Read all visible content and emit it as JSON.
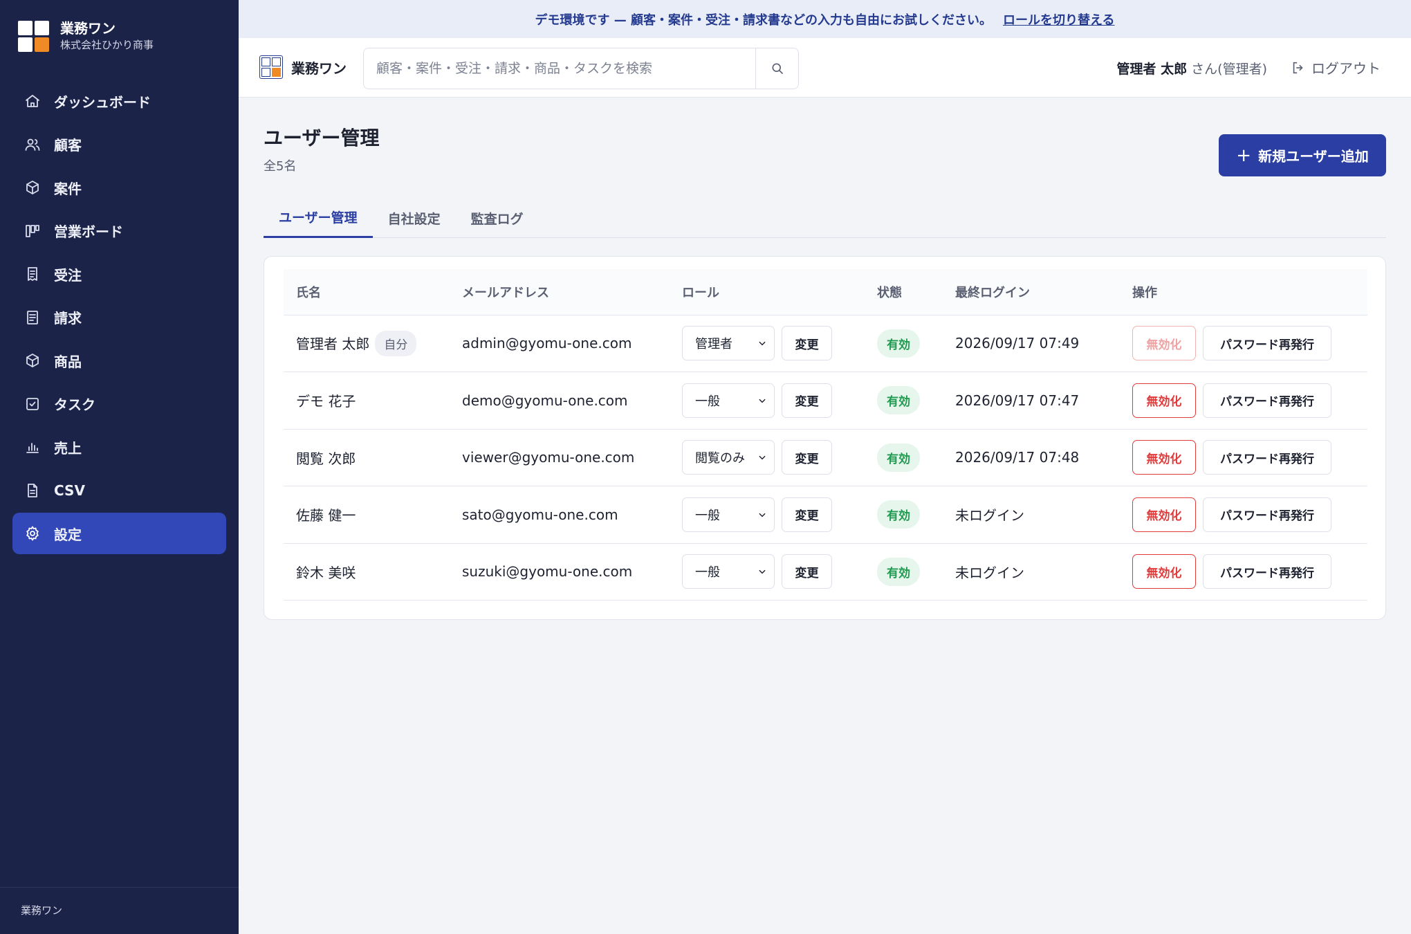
{
  "sidebar": {
    "app_name": "業務ワン",
    "company": "株式会社ひかり商事",
    "items": [
      {
        "label": "ダッシュボード",
        "icon": "home-icon"
      },
      {
        "label": "顧客",
        "icon": "users-icon"
      },
      {
        "label": "案件",
        "icon": "box-icon"
      },
      {
        "label": "営業ボード",
        "icon": "kanban-icon"
      },
      {
        "label": "受注",
        "icon": "receipt-icon"
      },
      {
        "label": "請求",
        "icon": "invoice-icon"
      },
      {
        "label": "商品",
        "icon": "package-icon"
      },
      {
        "label": "タスク",
        "icon": "check-square-icon"
      },
      {
        "label": "売上",
        "icon": "bar-chart-icon"
      },
      {
        "label": "CSV",
        "icon": "file-icon"
      },
      {
        "label": "設定",
        "icon": "gear-icon",
        "active": true
      }
    ],
    "footer": "業務ワン"
  },
  "banner": {
    "text": "デモ環境です — 顧客・案件・受注・請求書などの入力も自由にお試しください。",
    "link": "ロールを切り替える"
  },
  "header": {
    "app_name": "業務ワン",
    "search_placeholder": "顧客・案件・受注・請求・商品・タスクを検索",
    "user_name": "管理者 太郎",
    "user_suffix": "さん(管理者)",
    "logout": "ログアウト"
  },
  "page": {
    "title": "ユーザー管理",
    "count": "全5名",
    "add_button": "新規ユーザー追加",
    "tabs": [
      "ユーザー管理",
      "自社設定",
      "監査ログ"
    ]
  },
  "table": {
    "headers": [
      "氏名",
      "メールアドレス",
      "ロール",
      "状態",
      "最終ログイン",
      "操作"
    ],
    "change_label": "変更",
    "disable_label": "無効化",
    "reset_label": "パスワード再発行",
    "self_badge": "自分",
    "rows": [
      {
        "name": "管理者 太郎",
        "email": "admin@gyomu-one.com",
        "role": "管理者",
        "status": "有効",
        "last_login": "2026/09/17 07:49"
      },
      {
        "name": "デモ 花子",
        "email": "demo@gyomu-one.com",
        "role": "一般",
        "status": "有効",
        "last_login": "2026/09/17 07:47"
      },
      {
        "name": "閲覧 次郎",
        "email": "viewer@gyomu-one.com",
        "role": "閲覧のみ",
        "status": "有効",
        "last_login": "2026/09/17 07:48"
      },
      {
        "name": "佐藤 健一",
        "email": "sato@gyomu-one.com",
        "role": "一般",
        "status": "有効",
        "last_login": "未ログイン"
      },
      {
        "name": "鈴木 美咲",
        "email": "suzuki@gyomu-one.com",
        "role": "一般",
        "status": "有効",
        "last_login": "未ログイン"
      }
    ]
  },
  "colors": {
    "sidebar_bg": "#1c2348",
    "accent": "#2b3ea3",
    "danger": "#e03b3b",
    "success": "#1f9a4e",
    "logo_orange": "#f08a24"
  }
}
